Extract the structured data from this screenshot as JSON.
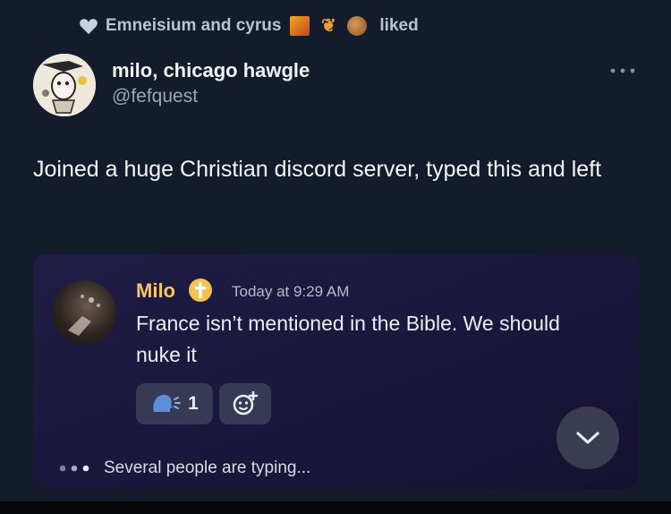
{
  "liked_bar": {
    "names": "Emneisium and cyrus",
    "suffix": "liked",
    "emojis": [
      "building-emoji",
      "leaf-emoji",
      "cookie-emoji"
    ]
  },
  "post": {
    "author_name": "milo, chicago hawgle",
    "author_handle": "@fefquest",
    "text": "Joined a huge Christian discord server, typed this and left"
  },
  "discord": {
    "username": "Milo",
    "username_color": "#f5c56a",
    "timestamp": "Today at 9:29 AM",
    "message": "France isn’t mentioned in the Bible. We should nuke it",
    "reaction_count": "1",
    "typing_text": "Several people are typing..."
  }
}
